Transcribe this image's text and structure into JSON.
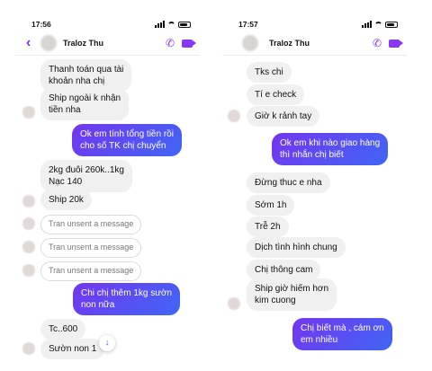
{
  "left": {
    "time": "17:56",
    "contact": "Traloz Thu",
    "messages": {
      "m1": "Thanh toán qua tài\nkhoản nha  chị",
      "m2": "Ship  ngoài  k  nhận\ntiền  nha",
      "m3": "Ok em tính tổng tiền rồi\ncho số TK chị chuyển",
      "m4": "2kg  đuôi 260k..1kg\nNạc 140",
      "m5": "Ship 20k",
      "m6": "Tran unsent a message",
      "m7": "Tran unsent a message",
      "m8": "Tran unsent a message",
      "m9": "Chi chị thêm 1kg sườn\nnon nữa",
      "m10": "Tc..600",
      "m11": "Sườn  non 1"
    },
    "scroll_icon": "arrow-down-icon"
  },
  "right": {
    "time": "17:57",
    "contact": "Traloz Thu",
    "messages": {
      "m1": "Tks  chi",
      "m2": "Tí  e check",
      "m3": "Giờ  k rảnh  tay",
      "m4": "Ok em khi nào giao hàng\nthì nhắn chị biết",
      "m5": "Đừng thuc e nha",
      "m6": "Sớm  1h",
      "m7": "Trễ  2h",
      "m8": "Dịch  tình hình  chung",
      "m9": "Chị  thông  cam",
      "m10": "Ship  giờ  hiếm  hơn\nkim  cuong",
      "m11": "Chị biết mà , cám ơn\nem nhiều"
    }
  },
  "colors": {
    "accent": "#8b35f5",
    "bubble_out_start": "#7435f0",
    "bubble_out_end": "#3f66f5",
    "bubble_in": "#f0f0f0"
  }
}
